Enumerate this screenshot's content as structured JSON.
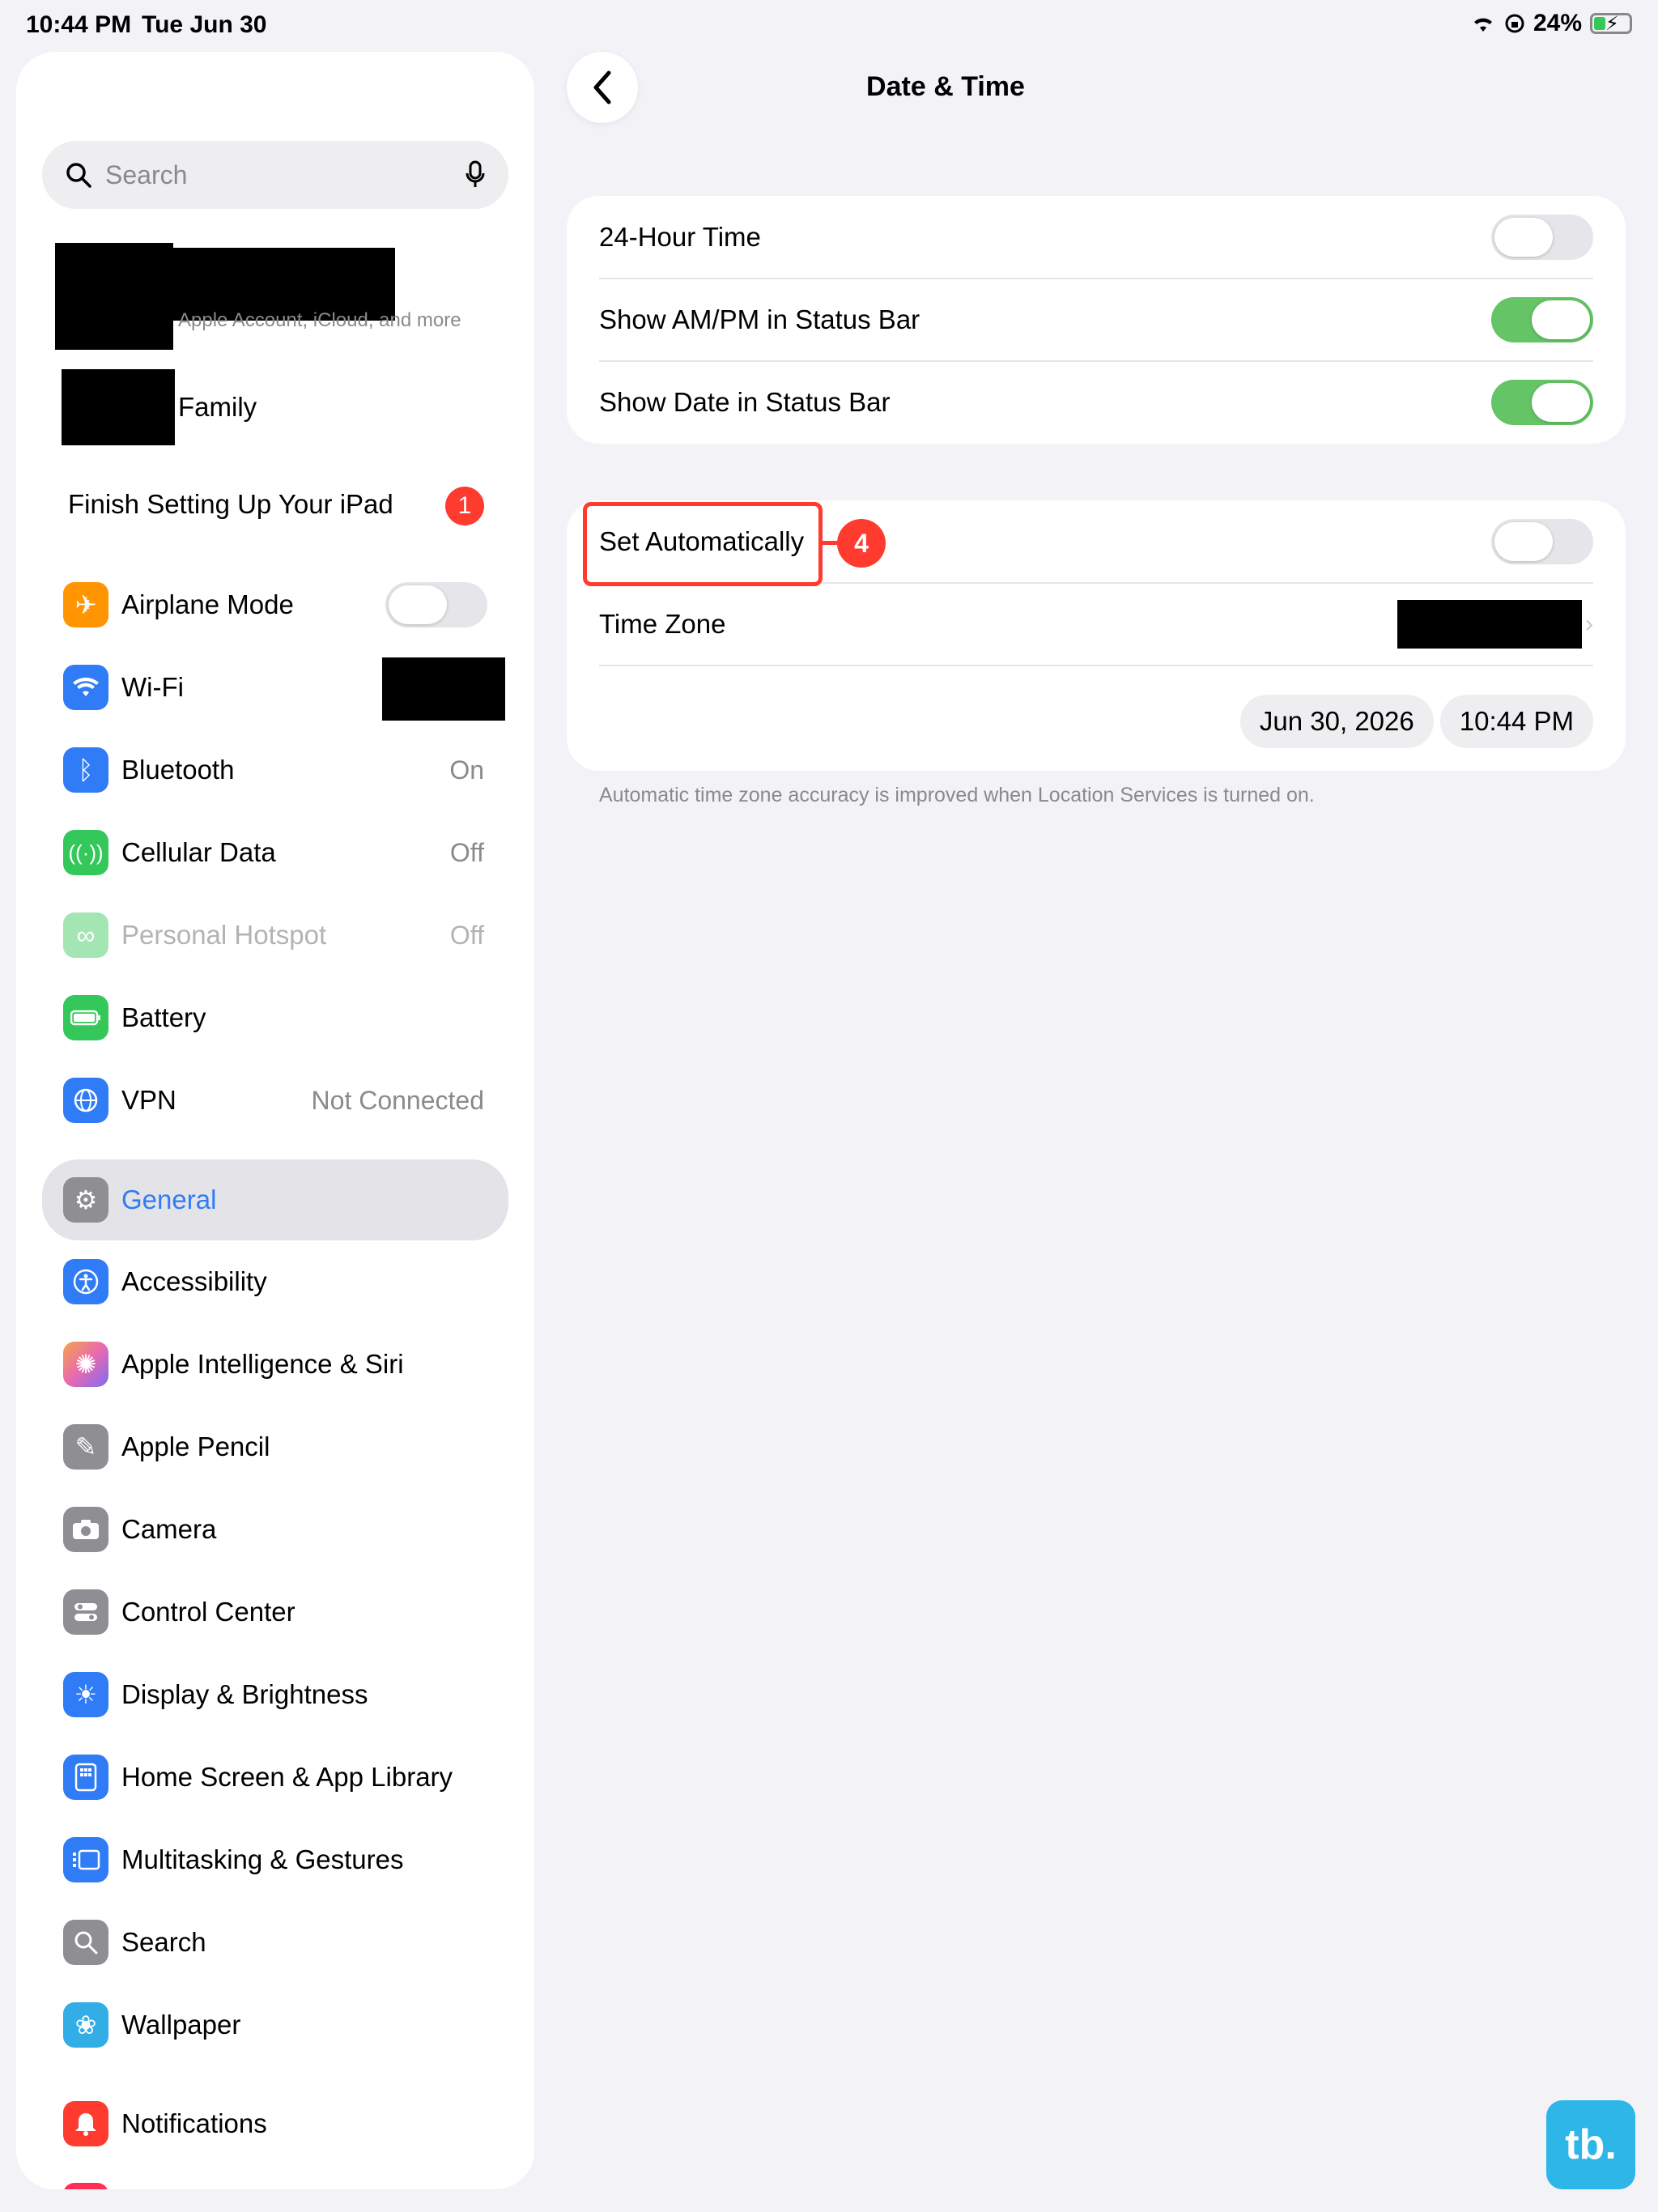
{
  "status_bar": {
    "time": "10:44 PM",
    "date": "Tue Jun 30",
    "battery": "24%"
  },
  "sidebar": {
    "search_placeholder": "Search",
    "account_subtitle": "Apple Account, iCloud, and more",
    "family_label": "Family",
    "finish_setup_label": "Finish Setting Up Your iPad",
    "finish_setup_badge": "1",
    "items": [
      {
        "label": "Airplane Mode",
        "value": "",
        "icon": "airplane-icon",
        "color": "#ff9500"
      },
      {
        "label": "Wi-Fi",
        "value": "",
        "icon": "wifi-icon",
        "color": "#2f7cf6"
      },
      {
        "label": "Bluetooth",
        "value": "On",
        "icon": "bluetooth-icon",
        "color": "#2f7cf6"
      },
      {
        "label": "Cellular Data",
        "value": "Off",
        "icon": "cellular-icon",
        "color": "#34c759"
      },
      {
        "label": "Personal Hotspot",
        "value": "Off",
        "icon": "hotspot-icon",
        "color": "#34c759"
      },
      {
        "label": "Battery",
        "value": "",
        "icon": "battery-icon",
        "color": "#34c759"
      },
      {
        "label": "VPN",
        "value": "Not Connected",
        "icon": "globe-icon",
        "color": "#2f7cf6"
      },
      {
        "label": "General",
        "value": "",
        "icon": "gear-icon",
        "color": "#8e8e93"
      },
      {
        "label": "Accessibility",
        "value": "",
        "icon": "accessibility-icon",
        "color": "#2f7cf6"
      },
      {
        "label": "Apple Intelligence & Siri",
        "value": "",
        "icon": "siri-icon",
        "color": "#e86ab0"
      },
      {
        "label": "Apple Pencil",
        "value": "",
        "icon": "pencil-icon",
        "color": "#8e8e93"
      },
      {
        "label": "Camera",
        "value": "",
        "icon": "camera-icon",
        "color": "#8e8e93"
      },
      {
        "label": "Control Center",
        "value": "",
        "icon": "control-center-icon",
        "color": "#8e8e93"
      },
      {
        "label": "Display & Brightness",
        "value": "",
        "icon": "sun-icon",
        "color": "#2f7cf6"
      },
      {
        "label": "Home Screen & App Library",
        "value": "",
        "icon": "home-screen-icon",
        "color": "#2f7cf6"
      },
      {
        "label": "Multitasking & Gestures",
        "value": "",
        "icon": "multitasking-icon",
        "color": "#2f7cf6"
      },
      {
        "label": "Search",
        "value": "",
        "icon": "magnifier-icon",
        "color": "#8e8e93"
      },
      {
        "label": "Wallpaper",
        "value": "",
        "icon": "flower-icon",
        "color": "#32ade6"
      },
      {
        "label": "Notifications",
        "value": "",
        "icon": "bell-icon",
        "color": "#ff3b30"
      }
    ]
  },
  "detail": {
    "title": "Date & Time",
    "rows": {
      "hour24": "24-Hour Time",
      "ampm": "Show AM/PM in Status Bar",
      "show_date": "Show Date in Status Bar",
      "set_auto": "Set Automatically",
      "time_zone": "Time Zone"
    },
    "toggles": {
      "hour24": false,
      "ampm": true,
      "show_date": true,
      "set_auto": false
    },
    "date_value": "Jun 30, 2026",
    "time_value": "10:44 PM",
    "footnote": "Automatic time zone accuracy is improved when Location Services is turned on."
  },
  "annotation": {
    "step": "4"
  },
  "logo_text": "tb."
}
